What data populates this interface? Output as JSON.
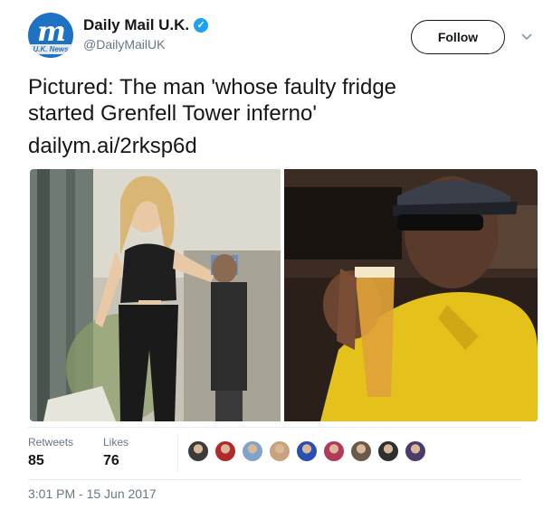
{
  "account": {
    "display_name": "Daily Mail U.K.",
    "handle": "@DailyMailUK",
    "avatar_letters": "m",
    "avatar_ribbon": "U.K. News",
    "verified_icon": "verified-badge-icon"
  },
  "actions": {
    "follow_label": "Follow",
    "menu_icon": "chevron-down-icon"
  },
  "tweet": {
    "text_line_1": "Pictured: The man 'whose faulty fridge",
    "text_line_2": "started Grenfell Tower inferno'",
    "link": "dailym.ai/2rksp6d"
  },
  "media": {
    "photo_left": "photo-woman-street",
    "photo_right": "photo-man-drinking-beer"
  },
  "stats": {
    "retweets_label": "Retweets",
    "retweets_count": "85",
    "likes_label": "Likes",
    "likes_count": "76"
  },
  "likers": [
    {
      "name": "liker-1",
      "color": "#3b3b3b"
    },
    {
      "name": "liker-2",
      "color": "#b02a2a"
    },
    {
      "name": "liker-3",
      "color": "#7fa3c9"
    },
    {
      "name": "liker-4",
      "color": "#c9a27f"
    },
    {
      "name": "liker-5",
      "color": "#2a4fb0"
    },
    {
      "name": "liker-6",
      "color": "#b03a5a"
    },
    {
      "name": "liker-7",
      "color": "#6a5a4a"
    },
    {
      "name": "liker-8",
      "color": "#2f2f2f"
    },
    {
      "name": "liker-9",
      "color": "#4a3b6b"
    }
  ],
  "timestamp": "3:01 PM - 15 Jun 2017",
  "colors": {
    "accent": "#1da1f2",
    "text": "#14171a",
    "muted": "#657786",
    "divider": "#e6ecf0",
    "brand": "#1d72c4"
  }
}
